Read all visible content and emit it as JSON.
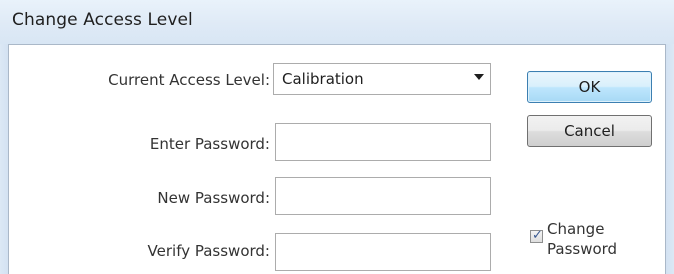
{
  "window": {
    "title": "Change Access Level"
  },
  "form": {
    "current_access_level_label": "Current Access Level:",
    "current_access_level_value": "Calibration",
    "enter_password_label": "Enter Password:",
    "enter_password_value": "",
    "new_password_label": "New Password:",
    "new_password_value": "",
    "verify_password_label": "Verify Password:",
    "verify_password_value": ""
  },
  "buttons": {
    "ok_label": "OK",
    "cancel_label": "Cancel"
  },
  "change_password": {
    "checked": true,
    "label_line1": "Change",
    "label_line2": "Password"
  },
  "icons": {
    "dropdown": "chevron-down-icon",
    "checkmark": "check-icon"
  },
  "colors": {
    "titlebar": "#dfeaf6",
    "default_button_border": "#3c7fb1",
    "field_border": "#acacac"
  }
}
